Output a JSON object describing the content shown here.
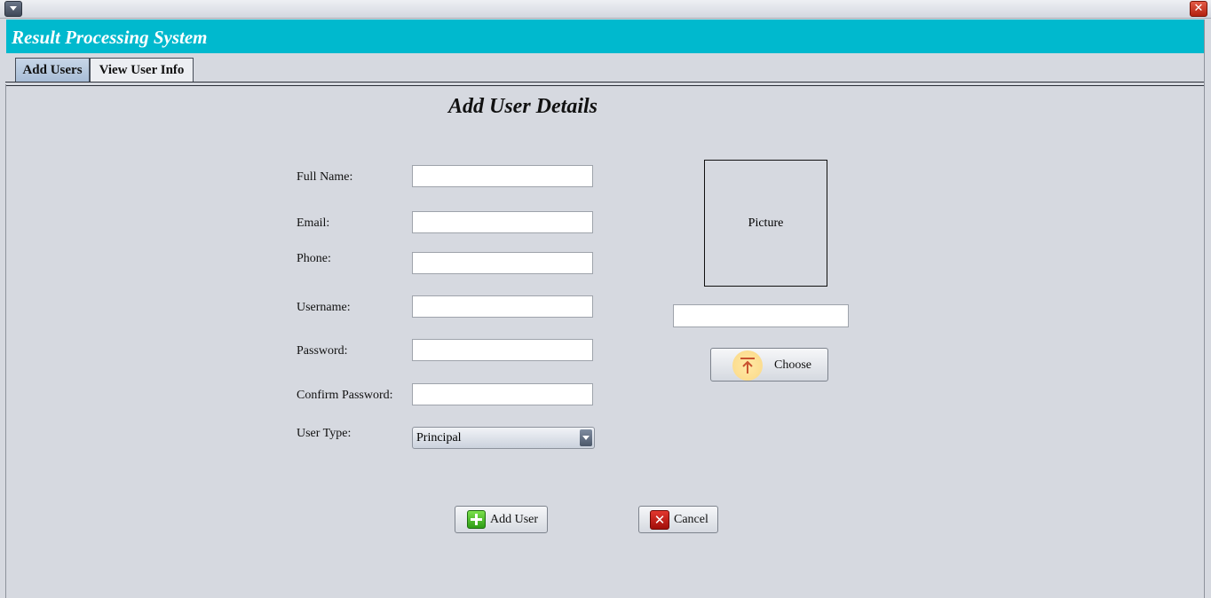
{
  "window": {
    "menu_icon": "dropdown-triangle-icon",
    "close_icon": "close-x-icon",
    "close_glyph": "✕"
  },
  "header": {
    "title": "Result Processing System",
    "background_color": "#00b9ce"
  },
  "tabs": [
    {
      "label": "Add Users",
      "active": true
    },
    {
      "label": "View User Info",
      "active": false
    }
  ],
  "form": {
    "title": "Add User Details",
    "fields": {
      "full_name": {
        "label": "Full Name:",
        "value": ""
      },
      "email": {
        "label": "Email:",
        "value": ""
      },
      "phone": {
        "label": "Phone:",
        "value": ""
      },
      "username": {
        "label": "Username:",
        "value": ""
      },
      "password": {
        "label": "Password:",
        "value": ""
      },
      "confirm_password": {
        "label": "Confirm Password:",
        "value": ""
      },
      "user_type": {
        "label": "User Type:",
        "selected": "Principal"
      }
    },
    "picture": {
      "label": "Picture",
      "path_value": "",
      "choose_label": "Choose",
      "choose_icon": "upload-arrow-icon"
    },
    "actions": {
      "add_label": "Add User",
      "add_icon": "green-plus-icon",
      "cancel_label": "Cancel",
      "cancel_icon": "red-x-icon",
      "cancel_glyph": "✕"
    }
  }
}
